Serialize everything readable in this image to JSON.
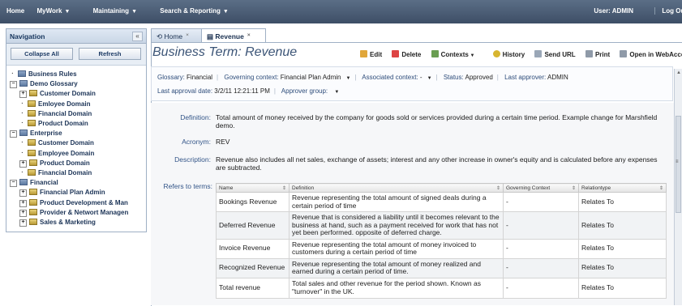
{
  "topbar": {
    "menu": [
      {
        "label": "Home",
        "caret": false
      },
      {
        "label": "MyWork",
        "caret": true
      },
      {
        "label": "Maintaining",
        "caret": true
      },
      {
        "label": "Search & Reporting",
        "caret": true
      }
    ],
    "user": "User: ADMIN",
    "logout": "Log Out"
  },
  "nav": {
    "title": "Navigation",
    "collapse_icon": "«",
    "collapse_all": "Collapse All",
    "refresh": "Refresh",
    "tree": [
      {
        "label": "Business Rules",
        "level": 0,
        "exp": "",
        "icon": "folder"
      },
      {
        "label": "Demo Glossary",
        "level": 0,
        "exp": "−",
        "icon": "folder"
      },
      {
        "label": "Customer Domain",
        "level": 1,
        "exp": "+",
        "icon": "doc"
      },
      {
        "label": "Emloyee Domain",
        "level": 1,
        "exp": "",
        "icon": "doc"
      },
      {
        "label": "Financial Domain",
        "level": 1,
        "exp": "",
        "icon": "doc"
      },
      {
        "label": "Product Domain",
        "level": 1,
        "exp": "",
        "icon": "doc"
      },
      {
        "label": "Enterprise",
        "level": 0,
        "exp": "−",
        "icon": "folder"
      },
      {
        "label": "Customer Domain",
        "level": 1,
        "exp": "",
        "icon": "doc"
      },
      {
        "label": "Employee Domain",
        "level": 1,
        "exp": "",
        "icon": "doc"
      },
      {
        "label": "Product Domain",
        "level": 1,
        "exp": "+",
        "icon": "doc"
      },
      {
        "label": "Financial Domain",
        "level": 1,
        "exp": "",
        "icon": "doc"
      },
      {
        "label": "Financial",
        "level": 0,
        "exp": "−",
        "icon": "folder"
      },
      {
        "label": "Financial Plan Admin",
        "level": 1,
        "exp": "+",
        "icon": "doc"
      },
      {
        "label": "Product Development & Man",
        "level": 1,
        "exp": "+",
        "icon": "doc"
      },
      {
        "label": "Provider & Networt Managen",
        "level": 1,
        "exp": "+",
        "icon": "doc"
      },
      {
        "label": "Sales & Marketing",
        "level": 1,
        "exp": "+",
        "icon": "doc"
      }
    ]
  },
  "tabs": [
    {
      "label": "Home",
      "close": "×"
    },
    {
      "label": "Revenue",
      "close": "×"
    }
  ],
  "page": {
    "title": "Business Term: Revenue",
    "toolbar": [
      "Edit",
      "Delete",
      "Contexts",
      "History",
      "Send URL",
      "Print",
      "Open in WebAccess"
    ]
  },
  "meta": {
    "glossary_label": "Glossary:",
    "glossary": "Financial",
    "governing_label": "Governing context:",
    "governing": "Financial Plan Admin",
    "associated_label": "Associated context:",
    "associated": "-",
    "status_label": "Status:",
    "status": "Approved",
    "approver_label": "Last approver:",
    "approver": "ADMIN",
    "approval_date_label": "Last approval date:",
    "approval_date": "3/2/11 12:21:11 PM",
    "approver_group_label": "Approver group:"
  },
  "fields": {
    "definition_label": "Definition:",
    "definition": "Total amount of money received by the company for goods sold or services provided during a certain time period. Example change for Marshfield demo.",
    "acronym_label": "Acronym:",
    "acronym": "REV",
    "description_label": "Description:",
    "description": "Revenue also includes all net sales, exchange of assets; interest and any other increase in owner's equity and is calculated before any expenses are subtracted.",
    "refers_label": "Refers to terms:"
  },
  "refs": {
    "headers": [
      "Name",
      "Definition",
      "Governing Context",
      "Relationtype"
    ],
    "rows": [
      {
        "name": "Bookings Revenue",
        "definition": "Revenue representing the total amount of signed deals during a certain period of time",
        "context": "-",
        "type": "Relates To"
      },
      {
        "name": "Deferred Revenue",
        "definition": "Revenue that is considered a liability until it becomes relevant to the business at hand, such as a payment received for work that has not yet been performed. opposite of deferred charge.",
        "context": "-",
        "type": "Relates To"
      },
      {
        "name": "Invoice Revenue",
        "definition": "Revenue representing the total amount of money invoiced to customers during a certain period of time",
        "context": "-",
        "type": "Relates To"
      },
      {
        "name": "Recognized Revenue",
        "definition": "Revenue representing the total amount of money realized and earned during a certain period of time.",
        "context": "-",
        "type": "Relates To"
      },
      {
        "name": "Total revenue",
        "definition": "Total sales and other revenue for the period shown. Known as \"turnover\" in the UK.",
        "context": "-",
        "type": "Relates To"
      }
    ]
  },
  "colors": {
    "topbar": "#3d4e66",
    "link": "#2d4c7a",
    "nav_text": "#1c3457"
  }
}
